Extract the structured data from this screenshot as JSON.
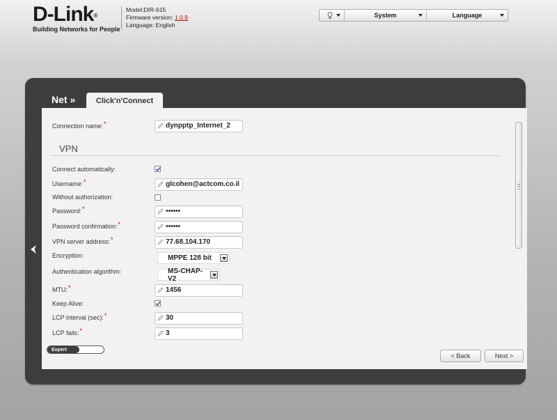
{
  "header": {
    "logo": {
      "brand": "D-Link",
      "reg_mark": "®",
      "tagline": "Building Networks for People"
    },
    "model_line": "Model:DIR-615",
    "firmware_label": "Firmware version: ",
    "firmware_value": "1.0.9",
    "language_line": "Language: English",
    "menu": {
      "system": "System",
      "language": "Language",
      "hint_icon": "lightbulb-icon"
    }
  },
  "nav": {
    "title": "Net »",
    "tab": "Click'n'Connect",
    "back_icon": "left-arrow-icon"
  },
  "form": {
    "connection_name": {
      "label": "Connection name:",
      "required": "*",
      "value": "dynpptp_Internet_2"
    },
    "vpn_heading": "VPN",
    "connect_auto": {
      "label": "Connect automatically:",
      "checked": true
    },
    "username": {
      "label": "Username:",
      "required": "*",
      "value": "glcohen@actcom.co.il"
    },
    "without_auth": {
      "label": "Without authorization:",
      "checked": false
    },
    "password": {
      "label": "Password:",
      "required": "*",
      "value": "••••••"
    },
    "password_confirm": {
      "label": "Password confirmation:",
      "required": "*",
      "value": "••••••"
    },
    "vpn_server": {
      "label": "VPN server address:",
      "required": "*",
      "value": "77.68.104.170"
    },
    "encryption": {
      "label": "Encryption:",
      "value": "MPPE 128 bit"
    },
    "auth_algorithm": {
      "label": "Authentication algorithm:",
      "value": "MS-CHAP-V2"
    },
    "mtu": {
      "label": "MTU:",
      "required": "*",
      "value": "1456"
    },
    "keep_alive": {
      "label": "Keep Alive:",
      "checked": true
    },
    "lcp_interval": {
      "label": "LCP interval (sec):",
      "required": "*",
      "value": "30"
    },
    "lcp_fails": {
      "label": "LCP fails:",
      "required": "*",
      "value": "3"
    }
  },
  "footer": {
    "expert_label": "Expert",
    "back_label": "< Back",
    "next_label": "Next >"
  },
  "colors": {
    "panel": "#3d3d3d",
    "content": "#f2f2f2",
    "required": "#cc0000",
    "firmware": "#bb0000"
  }
}
